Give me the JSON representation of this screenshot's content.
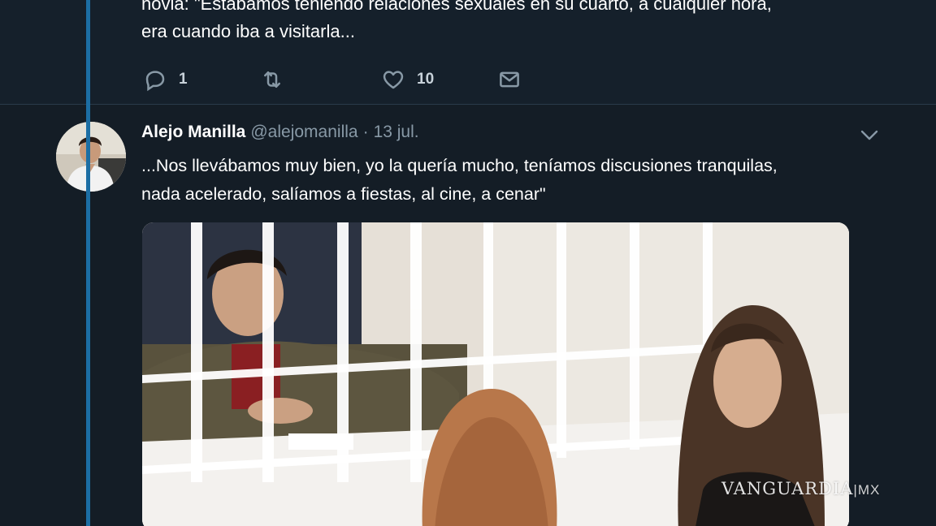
{
  "previous_tweet": {
    "text_lines": [
      "novia: \"Estábamos teniendo relaciones sexuales en su cuarto, a cualquier hora,",
      "era cuando iba a visitarla..."
    ],
    "actions": {
      "reply_count": "1",
      "retweet_count": "",
      "like_count": "10"
    }
  },
  "tweet": {
    "author_name": "Alejo Manilla",
    "handle": "@alejomanilla",
    "separator": "·",
    "date": "13 jul.",
    "text_lines": [
      "...Nos llevábamos muy bien, yo la quería mucho, teníamos discusiones tranquilas,",
      "nada acelerado, salíamos a fiestas, al cine, a cenar\""
    ]
  },
  "watermark": {
    "brand": "VANGUARDIA",
    "suffix": "MX"
  },
  "icons": {
    "reply": "reply-icon",
    "retweet": "retweet-icon",
    "like": "heart-icon",
    "dm": "envelope-icon",
    "more": "chevron-down-icon"
  },
  "colors": {
    "background": "#15202b",
    "thread_line": "#1c6ea4",
    "secondary_text": "#8899a6"
  }
}
